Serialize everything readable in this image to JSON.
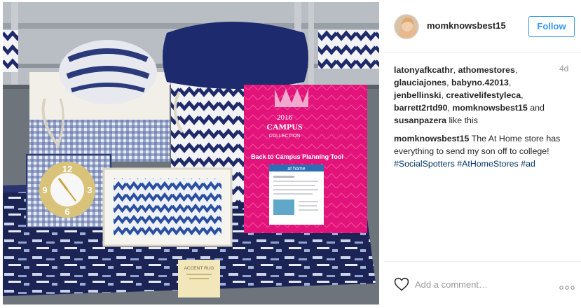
{
  "post": {
    "username": "momknowsbest15",
    "follow_label": "Follow",
    "time_ago": "4d",
    "likes": {
      "names": [
        "latonyafkcathr",
        "athomestores",
        "glauciajones",
        "babyno.42013",
        "jenbellinski",
        "creativelifestyleca",
        "barrett2rtd90",
        "momknowsbest15",
        "susanpazera"
      ],
      "and_text": "and",
      "suffix": "like this"
    },
    "caption": {
      "username": "momknowsbest15",
      "text": "The At Home store has everything to send my son off to college!",
      "hashtags": [
        "#SocialSpotters",
        "#AtHomeStores",
        "#ad"
      ]
    },
    "comment_placeholder": "Add a comment…"
  },
  "photo": {
    "sign_title_line1": "2016",
    "sign_title_line2": "CAMPUS",
    "sign_title_line3": "COLLECTION",
    "sign_banner": "Back to Campus Planning Tool",
    "sign_brand": "at home",
    "clock_numbers": [
      "12",
      "3",
      "6",
      "9"
    ],
    "rug_label": "ACCENT RUG"
  },
  "colors": {
    "accent": "#3897f0",
    "hashtag": "#003569",
    "sign_pink": "#e2137a",
    "navy": "#1f2a6b"
  },
  "icons": {
    "like": "heart-icon",
    "more": "more-options-icon"
  }
}
